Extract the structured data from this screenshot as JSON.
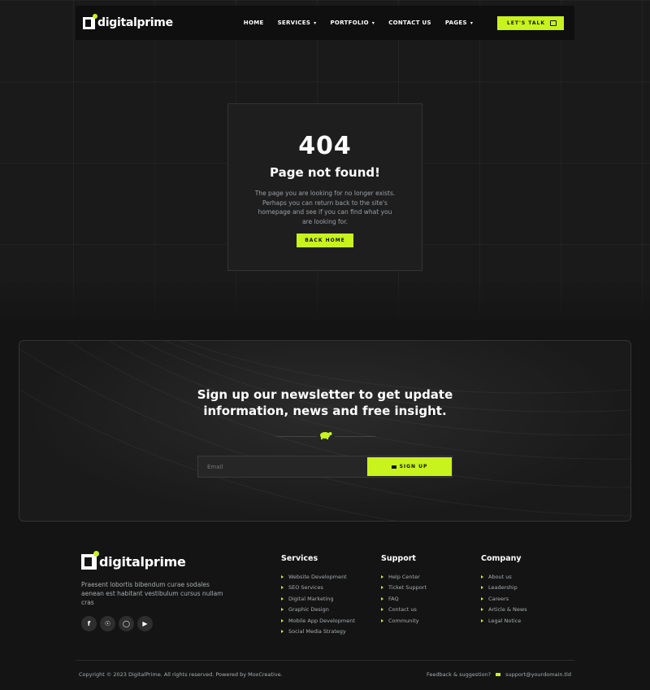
{
  "nav": {
    "brand": "digitalprime",
    "items": [
      {
        "label": "HOME",
        "dropdown": false
      },
      {
        "label": "SERVICES",
        "dropdown": true
      },
      {
        "label": "PORTFOLIO",
        "dropdown": true
      },
      {
        "label": "CONTACT US",
        "dropdown": false
      },
      {
        "label": "PAGES",
        "dropdown": true
      }
    ],
    "cta": "LET'S TALK"
  },
  "error": {
    "code": "404",
    "title": "Page not found!",
    "description": "The page you are looking for no longer exists. Perhaps you can return back to the site's homepage and see if you can find what you are looking for.",
    "button": "BACK HOME"
  },
  "newsletter": {
    "title_line1": "Sign up our newsletter to get update",
    "title_line2": "information, news and free insight.",
    "placeholder": "Email",
    "button": "SIGN UP"
  },
  "footer": {
    "brand": "digitalprime",
    "description": "Praesent lobortis bibendum curae sodales aenean est habitant vestibulum cursus nullam cras",
    "socials": [
      "facebook-icon",
      "dribbble-icon",
      "instagram-icon",
      "youtube-icon"
    ],
    "columns": [
      {
        "title": "Services",
        "links": [
          "Website Development",
          "SEO Services",
          "Digital Marketing",
          "Graphic Design",
          "Mobile App Development",
          "Social Media Strategy"
        ]
      },
      {
        "title": "Support",
        "links": [
          "Help Center",
          "Ticket Support",
          "FAQ",
          "Contact us",
          "Community"
        ]
      },
      {
        "title": "Company",
        "links": [
          "About us",
          "Leadership",
          "Careers",
          "Article & News",
          "Legal Notice"
        ]
      }
    ],
    "copyright": "Copyright © 2023 DigitalPrime. All rights reserved. Powered by MoxCreative.",
    "feedback_label": "Feedback & suggestion?",
    "support_email": "support@yourdomain.tld"
  },
  "colors": {
    "accent": "#c8f31d",
    "background": "#141414",
    "card": "#1e1e1e"
  }
}
